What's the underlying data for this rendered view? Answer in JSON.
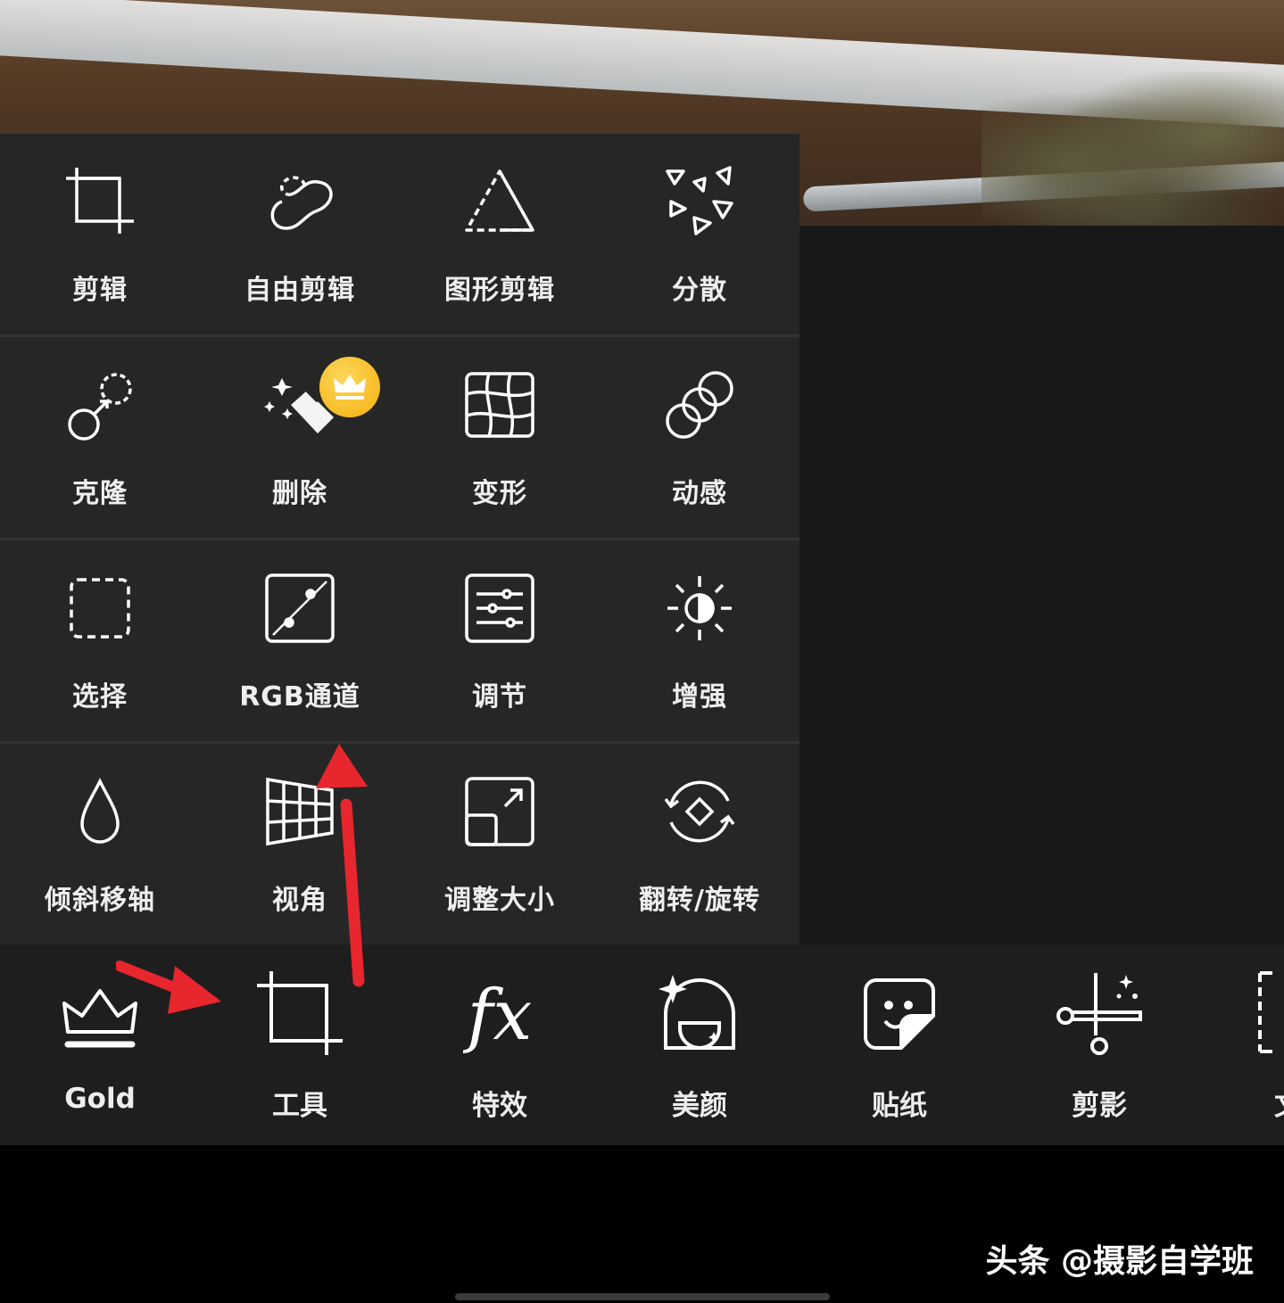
{
  "tools_panel": {
    "rows": [
      [
        {
          "label": "剪辑",
          "icon": "crop-icon"
        },
        {
          "label": "自由剪辑",
          "icon": "freeform-cut-icon"
        },
        {
          "label": "图形剪辑",
          "icon": "shape-cut-icon"
        },
        {
          "label": "分散",
          "icon": "disperse-icon"
        }
      ],
      [
        {
          "label": "克隆",
          "icon": "clone-icon"
        },
        {
          "label": "删除",
          "icon": "eraser-magic-icon",
          "premium": true
        },
        {
          "label": "变形",
          "icon": "warp-grid-icon"
        },
        {
          "label": "动感",
          "icon": "motion-circles-icon"
        }
      ],
      [
        {
          "label": "选择",
          "icon": "select-dashed-icon"
        },
        {
          "label": "RGB通道",
          "icon": "curves-icon"
        },
        {
          "label": "调节",
          "icon": "adjust-sliders-icon"
        },
        {
          "label": "增强",
          "icon": "enhance-sun-icon"
        }
      ],
      [
        {
          "label": "倾斜移轴",
          "icon": "drop-icon"
        },
        {
          "label": "视角",
          "icon": "perspective-grid-icon"
        },
        {
          "label": "调整大小",
          "icon": "resize-icon"
        },
        {
          "label": "翻转/旋转",
          "icon": "flip-rotate-icon"
        }
      ]
    ]
  },
  "bottom_bar": {
    "items": [
      {
        "label": "Gold",
        "icon": "crown-icon"
      },
      {
        "label": "工具",
        "icon": "crop-tool-icon"
      },
      {
        "label": "特效",
        "icon": "fx-icon"
      },
      {
        "label": "美颜",
        "icon": "beauty-face-icon"
      },
      {
        "label": "贴纸",
        "icon": "sticker-icon"
      },
      {
        "label": "剪影",
        "icon": "cutout-scissors-icon"
      },
      {
        "label": "文",
        "icon": "text-icon"
      }
    ]
  },
  "watermark": "头条 @摄影自学班",
  "colors": {
    "panel_bg": "#262626",
    "bar_bg": "#1e1e1e",
    "badge": "#f3b10e",
    "arrow": "#e8262d"
  }
}
